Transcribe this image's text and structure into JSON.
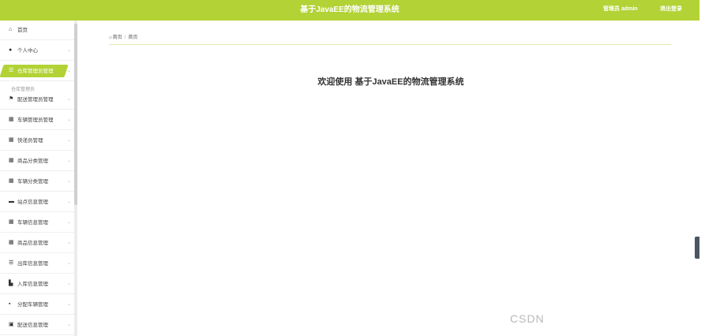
{
  "header": {
    "title": "基于JavaEE的物流管理系统",
    "user_label": "管理员 admin",
    "logout_label": "退出登录",
    "accent_color": "#b2d235"
  },
  "sidebar": {
    "items": [
      {
        "label": "首页",
        "icon": "home-icon"
      },
      {
        "label": "个人中心",
        "icon": "user-icon"
      },
      {
        "label": "仓库管理员管理",
        "icon": "list-icon",
        "active": true
      },
      {
        "label": "配送管理员管理",
        "icon": "flag-icon"
      },
      {
        "label": "车辆管理员管理",
        "icon": "grid-icon"
      },
      {
        "label": "快递员管理",
        "icon": "grid-icon"
      },
      {
        "label": "商品分类管理",
        "icon": "grid-icon"
      },
      {
        "label": "车辆分类管理",
        "icon": "grid-icon"
      },
      {
        "label": "站点信息管理",
        "icon": "briefcase-icon"
      },
      {
        "label": "车辆信息管理",
        "icon": "grid-icon"
      },
      {
        "label": "商品信息管理",
        "icon": "grid-icon"
      },
      {
        "label": "出库信息管理",
        "icon": "list-icon"
      },
      {
        "label": "入库信息管理",
        "icon": "chart-icon"
      },
      {
        "label": "分配车辆管理",
        "icon": "truck-icon"
      },
      {
        "label": "配送信息管理",
        "icon": "box-icon"
      }
    ],
    "submenu_hint": "仓库管理员"
  },
  "breadcrumb": {
    "home": "首页",
    "current": "首页"
  },
  "main": {
    "welcome": "欢迎使用 基于JavaEE的物流管理系统"
  },
  "watermark": "CSDN"
}
